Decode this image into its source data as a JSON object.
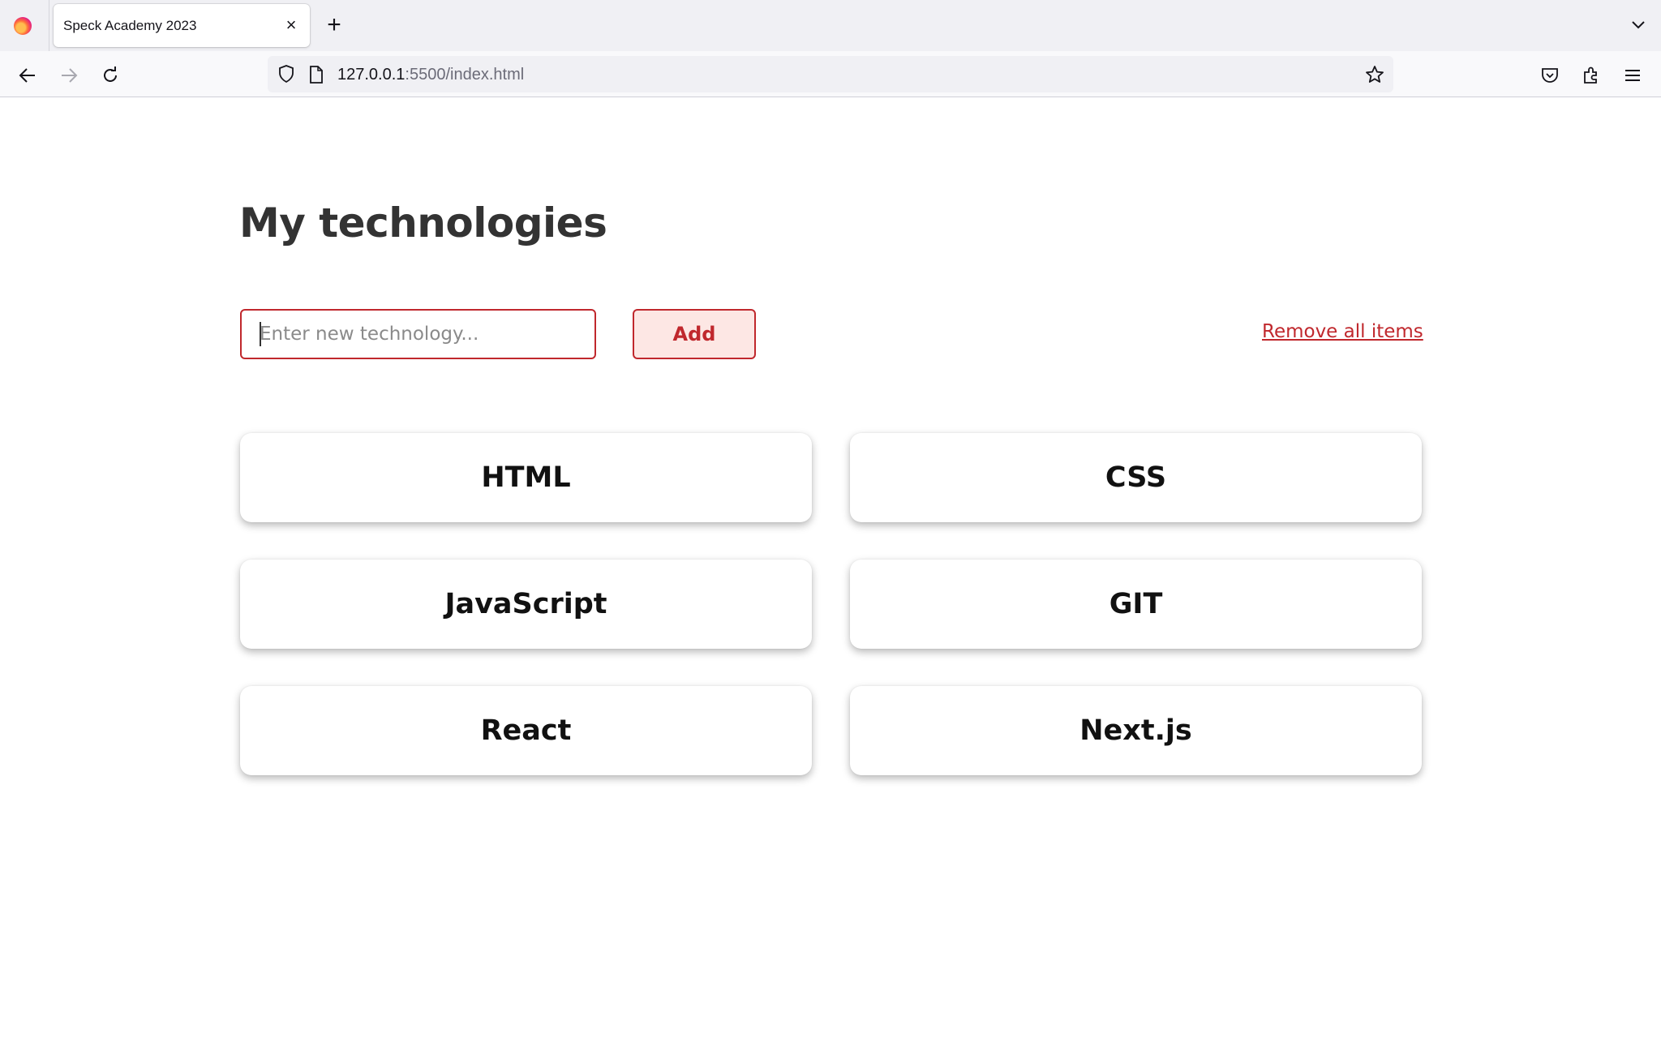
{
  "browser": {
    "tab_title": "Speck Academy 2023",
    "url_host": "127.0.0.1",
    "url_rest": ":5500/index.html"
  },
  "page": {
    "title": "My technologies",
    "input_placeholder": "Enter new technology...",
    "input_value": "",
    "add_label": "Add",
    "remove_all_label": "Remove all items",
    "technologies": [
      "HTML",
      "CSS",
      "JavaScript",
      "GIT",
      "React",
      "Next.js"
    ]
  },
  "colors": {
    "accent": "#c0282d",
    "add_button_bg": "#fde7e4",
    "title": "#333333"
  },
  "icons": {
    "browser_logo": "firefox-logo-icon",
    "tab_close": "close-icon",
    "new_tab": "plus-icon",
    "tab_list": "chevron-down-icon",
    "back": "arrow-left-icon",
    "forward": "arrow-right-icon",
    "reload": "reload-icon",
    "tracking": "shield-icon",
    "page": "page-icon",
    "bookmark": "star-icon",
    "pocket": "pocket-icon",
    "extensions": "puzzle-icon",
    "menu": "hamburger-menu-icon"
  }
}
